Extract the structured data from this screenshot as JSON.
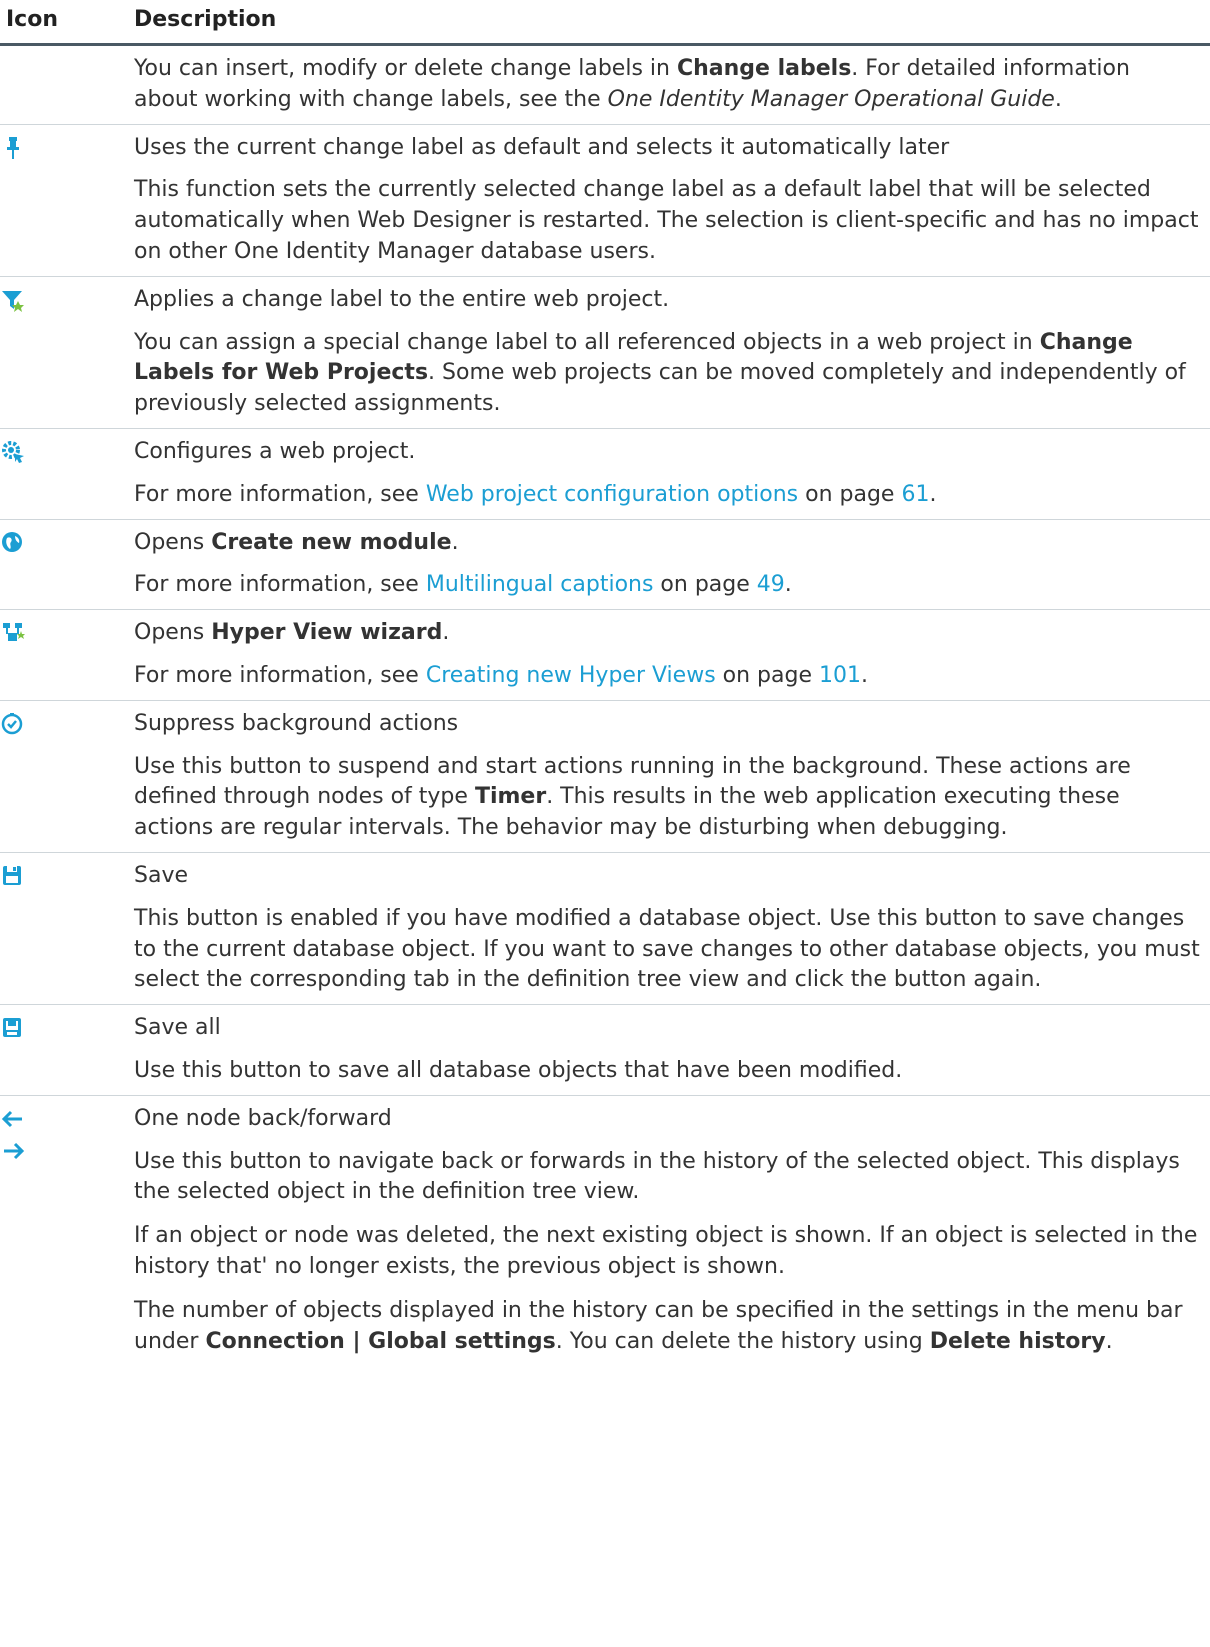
{
  "header": {
    "icon": "Icon",
    "description": "Description"
  },
  "rows": {
    "r0": {
      "icon": null,
      "p1": {
        "a": "You can insert, modify or delete change labels in ",
        "b": "Change labels",
        "c": ". For detailed information about working with change labels, see the ",
        "d": "One Identity Manager Operational Guide",
        "e": "."
      }
    },
    "r1": {
      "icon": "pin-icon",
      "title": "Uses the current change label as default and selects it automatically later",
      "body": "This function sets the currently selected change label as a default label that will be selected automatically when Web Designer is restarted. The selection is client-specific and has no impact on other One Identity Manager database users."
    },
    "r2": {
      "icon": "filter-apply-icon",
      "title": "Applies a change label to the entire web project.",
      "body": {
        "a": "You can assign a special change label to all referenced objects in a web project in ",
        "b": "Change Labels for Web Projects",
        "c": ". Some web projects can be moved completely and independently of previously selected assignments."
      }
    },
    "r3": {
      "icon": "gear-configure-icon",
      "title": "Configures a web project.",
      "body": {
        "a": "For more information, see ",
        "link": "Web project configuration options",
        "b": " on page ",
        "page": "61",
        "c": "."
      }
    },
    "r4": {
      "icon": "globe-module-icon",
      "title": {
        "a": "Opens ",
        "b": "Create new module",
        "c": "."
      },
      "body": {
        "a": "For more information, see ",
        "link": "Multilingual captions",
        "b": " on page ",
        "page": "49",
        "c": "."
      }
    },
    "r5": {
      "icon": "hyperview-wizard-icon",
      "title": {
        "a": "Opens ",
        "b": "Hyper View wizard",
        "c": "."
      },
      "body": {
        "a": "For more information, see ",
        "link": "Creating new Hyper Views",
        "b": " on page ",
        "page": "101",
        "c": "."
      }
    },
    "r6": {
      "icon": "clock-check-icon",
      "title": "Suppress background actions",
      "body": {
        "a": "Use this button to suspend and start actions running in the background. These actions are defined through nodes of type ",
        "b": "Timer",
        "c": ". This results in the web application executing these actions are regular intervals. The behavior may be disturbing when debugging."
      }
    },
    "r7": {
      "icon": "save-icon",
      "title": "Save",
      "body": "This button is enabled if you have modified a database object. Use this button to save changes to the current database object. If you want to save changes to other database objects, you must select the corresponding tab in the definition tree view and click the button again."
    },
    "r8": {
      "icon": "save-all-icon",
      "title": "Save all",
      "body": "Use this button to save all database objects that have been modified."
    },
    "r9": {
      "icons": [
        "arrow-back-icon",
        "arrow-forward-icon"
      ],
      "title": "One node back/forward",
      "p1": "Use this button to navigate back or forwards in the history of the selected object. This displays the selected object in the definition tree view.",
      "p2": "If an object or node was deleted, the next existing object is shown. If an object is selected in the history that' no longer exists, the previous object is shown.",
      "p3": {
        "a": "The number of objects displayed in the history can be specified in the settings in the menu bar under ",
        "b": "Connection | Global settings",
        "c": ". You can delete the history using ",
        "d": "Delete history",
        "e": "."
      }
    }
  },
  "colors": {
    "text": "#333333",
    "link": "#1b9ed3",
    "icon_blue": "#1b9ed3",
    "header_rule": "#4a5964",
    "row_rule": "#cfd6da"
  }
}
